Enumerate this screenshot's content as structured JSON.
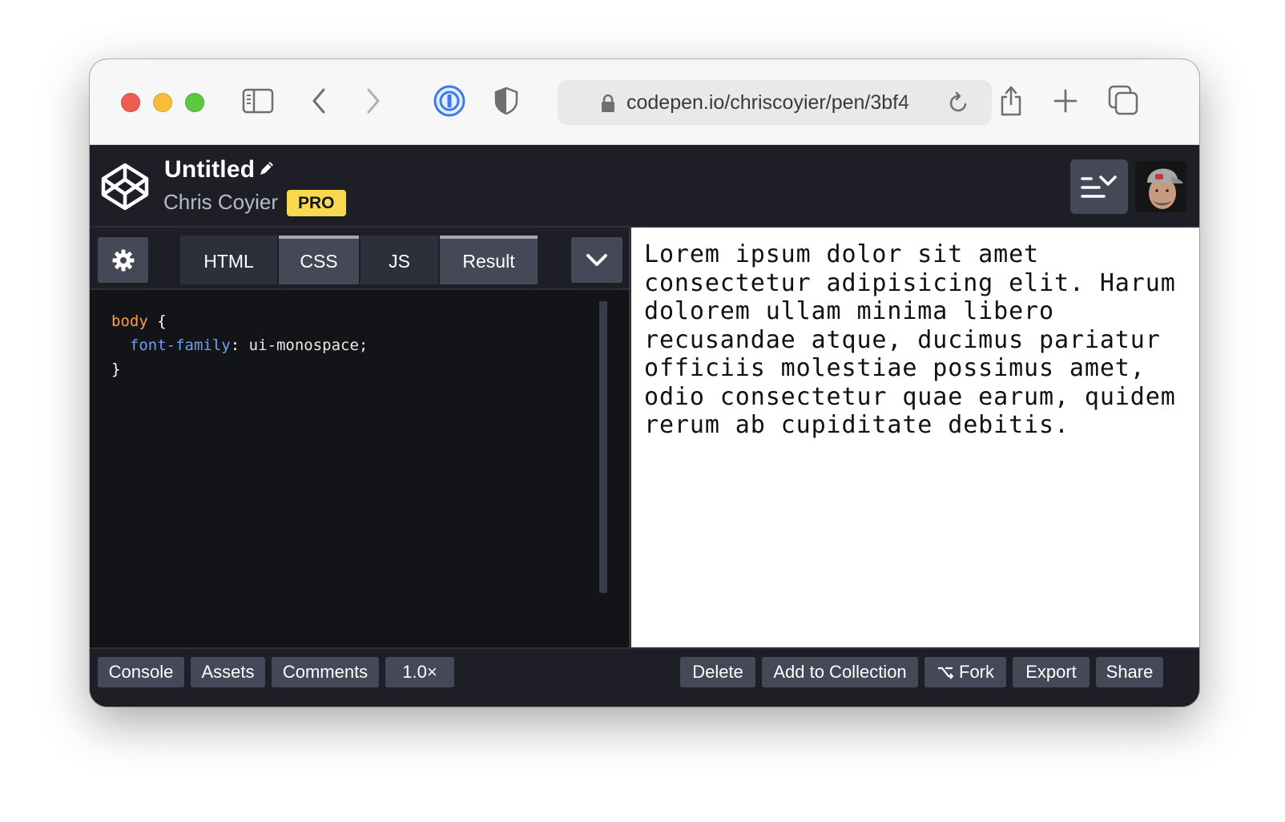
{
  "browser": {
    "url": "codepen.io/chriscoyier/pen/3bf4"
  },
  "pen": {
    "title": "Untitled",
    "author": "Chris Coyier",
    "badge": "PRO"
  },
  "editor": {
    "tabs": [
      {
        "label": "HTML",
        "active": false
      },
      {
        "label": "CSS",
        "active": true
      },
      {
        "label": "JS",
        "active": false
      },
      {
        "label": "Result",
        "active": true
      }
    ],
    "code": {
      "selector": "body",
      "open_brace": " {",
      "property": "font-family",
      "colon": ":",
      "value": " ui-monospace;",
      "close_brace": "}"
    }
  },
  "result": {
    "text": "Lorem ipsum dolor sit amet consectetur adipisicing elit. Harum dolorem ullam minima libero recusandae atque, ducimus pariatur officiis molestiae possimus amet, odio consectetur quae earum, quidem rerum ab cupiditate debitis."
  },
  "footer": {
    "left": [
      "Console",
      "Assets",
      "Comments",
      "1.0×"
    ],
    "delete": "Delete",
    "add_to_collection": "Add to Collection",
    "fork": "Fork",
    "export": "Export",
    "share": "Share"
  },
  "colors": {
    "accent_badge": "#f8d84e",
    "editor_bg": "#131417",
    "header_bg": "#1e1f26",
    "button_bg": "#444857",
    "selector": "#ff9c46",
    "property": "#6e9ef7"
  }
}
